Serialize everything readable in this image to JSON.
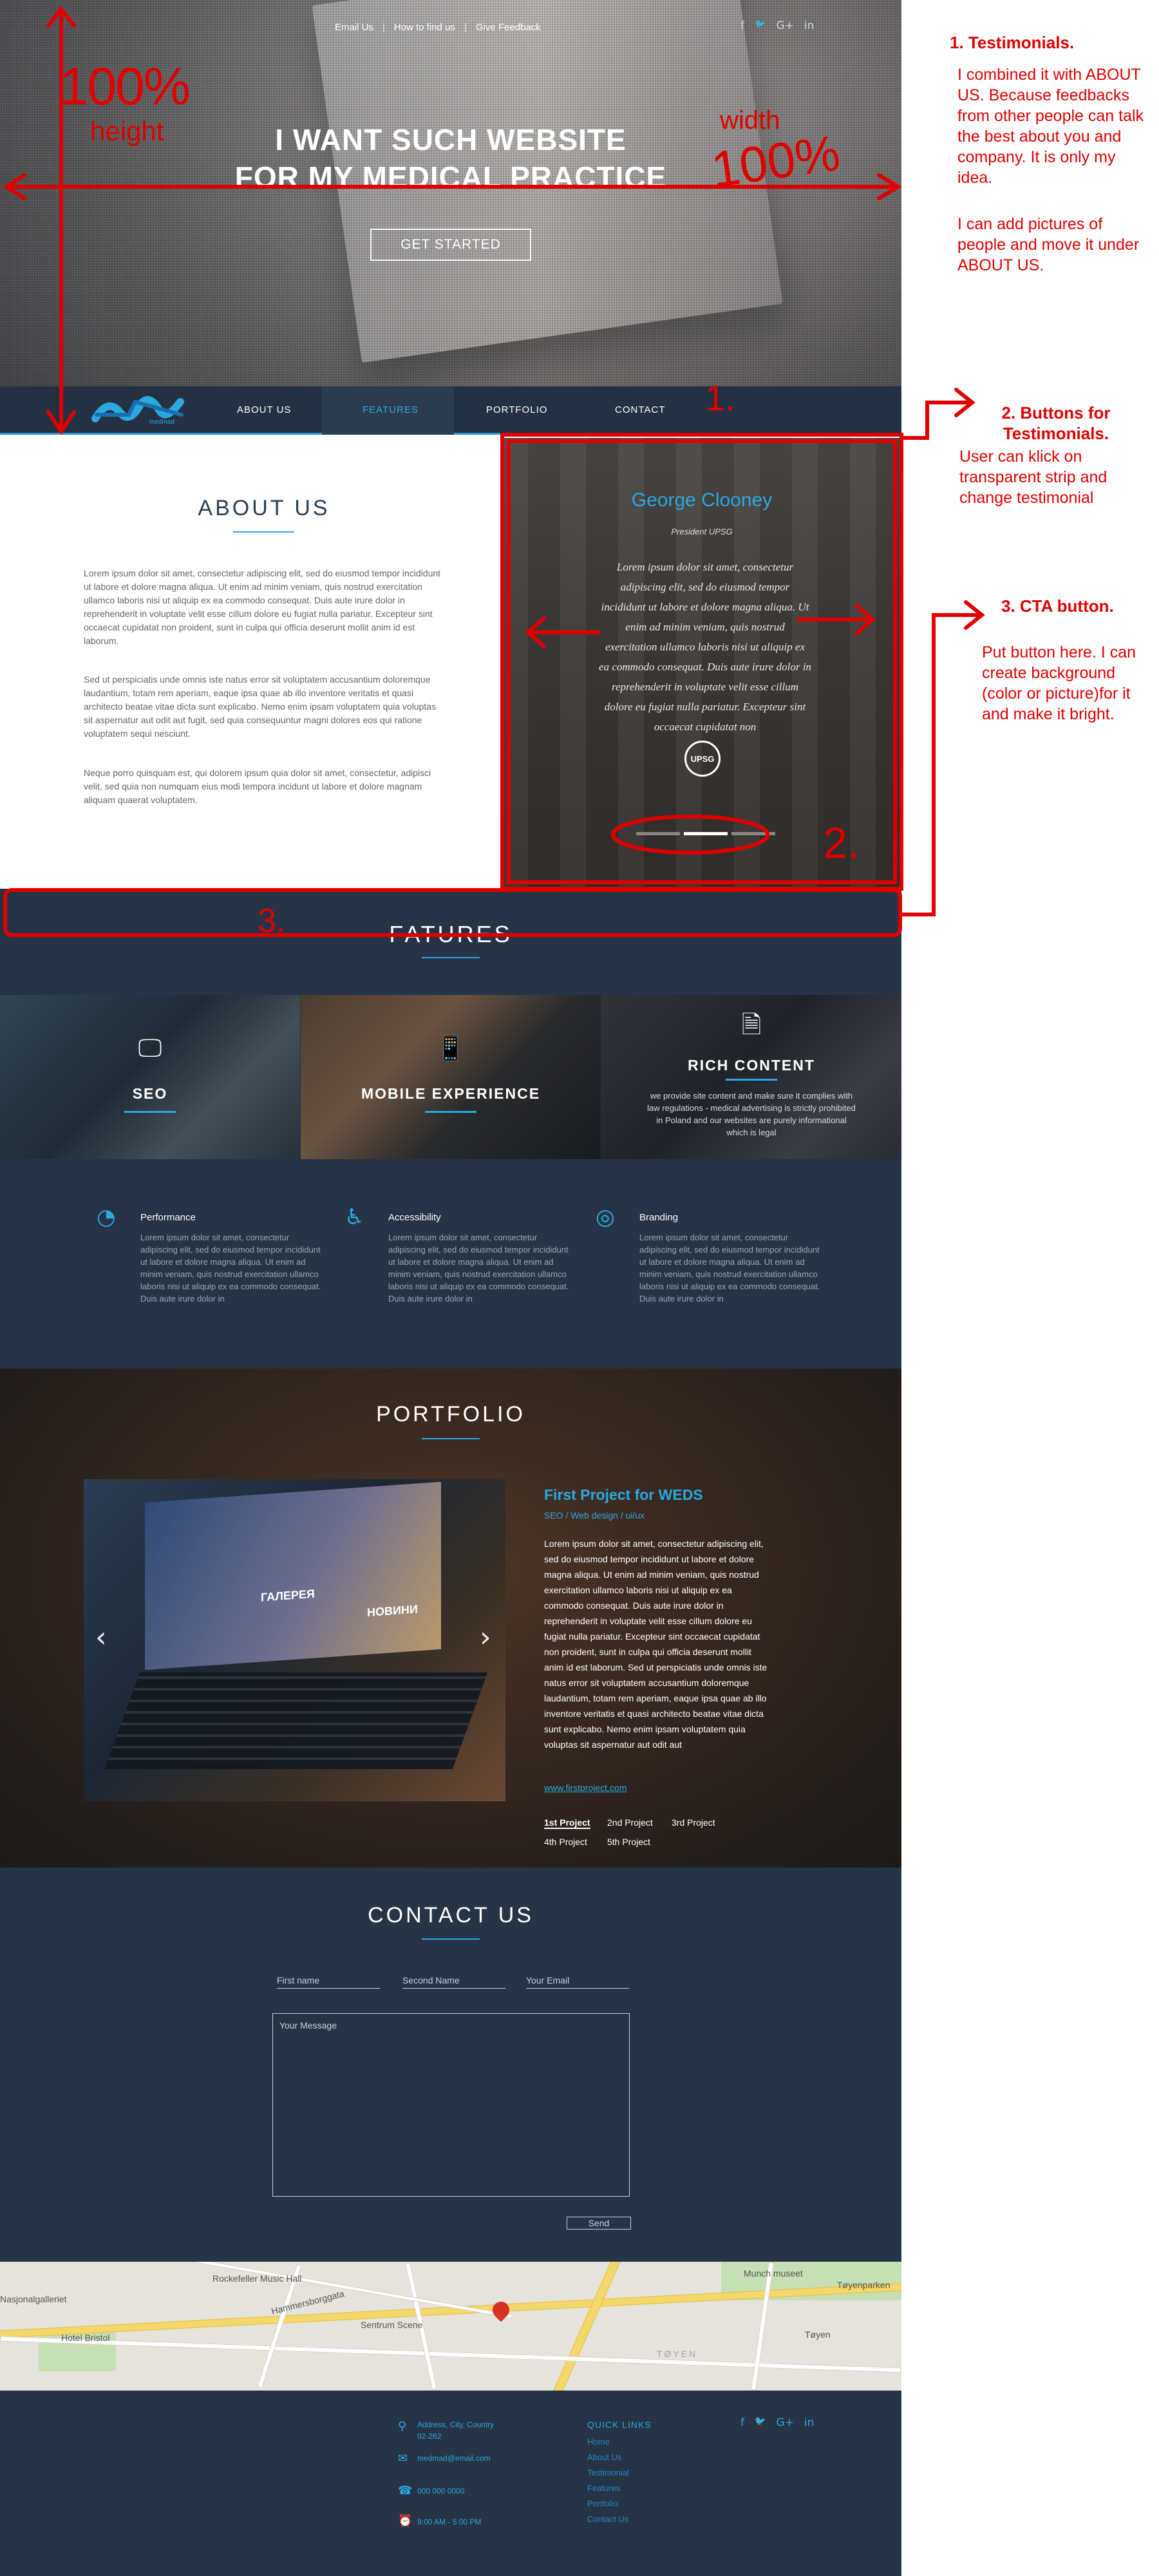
{
  "colors": {
    "accent": "#2aa8e0",
    "navy": "#263445",
    "annotation_red": "#e10000"
  },
  "top_links": [
    "Email Us",
    "How to find us",
    "Give Feedback"
  ],
  "socials": [
    {
      "icon": "facebook-icon",
      "glyph": "f"
    },
    {
      "icon": "twitter-icon",
      "glyph": "🐦"
    },
    {
      "icon": "google-plus-icon",
      "glyph": "G+"
    },
    {
      "icon": "linkedin-icon",
      "glyph": "in"
    }
  ],
  "hero": {
    "line1": "I WANT SUCH WEBSITE",
    "line2": "FOR MY MEDICAL PRACTICE",
    "cta": "GET STARTED"
  },
  "nav": {
    "logo": "medmad",
    "items": [
      "ABOUT US",
      "FEATURES",
      "PORTFOLIO",
      "CONTACT"
    ],
    "active": "FEATURES"
  },
  "about": {
    "title": "ABOUT US",
    "p1": "Lorem ipsum dolor sit amet, consectetur adipiscing elit, sed do eiusmod tempor incididunt ut labore et dolore magna aliqua. Ut enim ad minim veniam, quis nostrud exercitation ullamco laboris nisi ut aliquip ex ea commodo consequat. Duis aute irure dolor in reprehenderit in voluptate velit esse cillum dolore eu fugiat nulla pariatur. Excepteur sint occaecat cupidatat non proident, sunt in culpa qui officia deserunt mollit anim id est laborum.",
    "p2": "Sed ut perspiciatis unde omnis iste natus error sit voluptatem accusantium doloremque laudantium, totam rem aperiam, eaque ipsa quae ab illo inventore veritatis et quasi architecto beatae vitae dicta sunt explicabo. Nemo enim ipsam voluptatem quia voluptas sit aspernatur aut odit aut fugit, sed quia consequuntur magni dolores eos qui ratione voluptatem sequi nesciunt.",
    "p3": "Neque porro quisquam est, qui dolorem ipsum quia dolor sit amet, consectetur, adipisci velit, sed quia non numquam eius modi tempora incidunt ut labore et dolore magnam aliquam quaerat voluptatem."
  },
  "testimonial": {
    "name": "George Clooney",
    "role": "President UPSG",
    "quote": "Lorem ipsum dolor sit amet, consectetur adipiscing elit, sed do eiusmod tempor incididunt ut labore et dolore magna aliqua. Ut enim ad minim veniam, quis nostrud exercitation ullamco laboris nisi ut aliquip ex ea commodo consequat. Duis aute irure dolor in reprehenderit in voluptate velit esse cillum dolore eu fugiat nulla pariatur. Excepteur sint occaecat cupidatat non",
    "badge": "UPSG"
  },
  "features": {
    "title": "FATURES",
    "tiles": [
      "SEO",
      "MOBILE EXPERIENCE",
      "RICH CONTENT"
    ],
    "rich_desc": "we provide site content and make sure it complies with law regulations - medical advertising is strictly prohibited in Poland and our websites are purely informational which is legal",
    "cols": [
      {
        "title": "Performance",
        "icon": "gauge-icon"
      },
      {
        "title": "Accessibility",
        "icon": "accessibility-icon"
      },
      {
        "title": "Branding",
        "icon": "target-icon"
      }
    ],
    "col_text": "Lorem ipsum dolor sit amet, consectetur adipiscing elit, sed do eiusmod tempor incididunt ut labore et dolore magna aliqua. Ut enim ad minim veniam, quis nostrud exercitation ullamco laboris nisi ut aliquip ex ea commodo consequat. Duis aute irure dolor in"
  },
  "portfolio": {
    "title": "PORTFOLIO",
    "project_title": "First Project for WEDS",
    "project_sub": "SEO / Web design / ui/ux",
    "text": "Lorem ipsum dolor sit amet, consectetur adipiscing elit, sed do eiusmod tempor incididunt ut labore et dolore magna aliqua. Ut enim ad minim veniam, quis nostrud exercitation ullamco laboris nisi ut aliquip ex ea commodo consequat. Duis aute irure dolor in reprehenderit in voluptate velit esse cillum dolore eu fugiat nulla pariatur. Excepteur sint occaecat cupidatat non proident, sunt in culpa qui officia deserunt mollit anim id est laborum. Sed ut perspiciatis unde omnis iste natus error sit voluptatem accusantium doloremque laudantium, totam rem aperiam, eaque ipsa quae ab illo inventore veritatis et quasi architecto beatae vitae dicta sunt explicabo. Nemo enim ipsam voluptatem quia voluptas sit aspernatur aut odit aut",
    "link": "www.firstproject.com",
    "screen_left": "ГАЛЕРЕЯ",
    "screen_right": "НОВИНИ",
    "projects": [
      "1st Project",
      "2nd Project",
      "3rd Project",
      "4th Project",
      "5th Project"
    ]
  },
  "contact": {
    "title": "CONTACT US",
    "first": "First name",
    "second": "Second Name",
    "email": "Your Email",
    "message": "Your Message",
    "send": "Send"
  },
  "map": {
    "labels": [
      "Rockefeller Music Hall",
      "Hotel Bristol",
      "Sentrum Scene",
      "Nasjonalgalleriet",
      "Munch museet",
      "Tøyenparken",
      "Tøyen",
      "Hammersborggata",
      "TØYEN"
    ]
  },
  "footer": {
    "address": "Address, City, Country",
    "zip": "02-262",
    "email": "medmad@email.com",
    "phone": "000 000 0000",
    "hours": "9:00 AM - 5:00 PM",
    "quick_title": "QUICK LINKS",
    "links": [
      "Home",
      "About Us",
      "Testimonial",
      "Features",
      "Portfolio",
      "Contact Us"
    ]
  },
  "annotations": {
    "h100": "100%",
    "height": "height",
    "width": "width",
    "w100": "100%",
    "n1": "1.",
    "n2": "2.",
    "n3": "3.",
    "note1_title": "1. Testimonials.",
    "note1_body": "I combined it with ABOUT US. Because feedbacks from other people can talk the best about you and company. It is only my idea.",
    "note1_extra": "I can add pictures of people and move it under ABOUT US.",
    "note2_title": "2. Buttons for Testimonials.",
    "note2_body": "User can klick on transparent strip and change testimonial",
    "note3_title": "3. CTA button.",
    "note3_body": "Put button here. I can create background (color or picture)for it and make it bright."
  }
}
